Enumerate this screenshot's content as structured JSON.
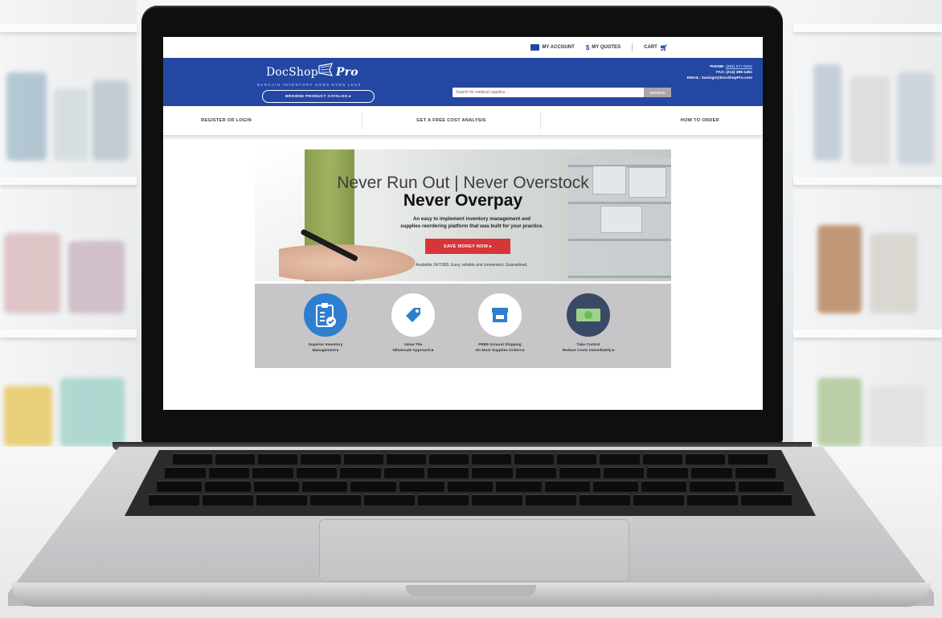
{
  "site": {
    "top_links": {
      "account": "MY ACCOUNT",
      "quotes": "MY QUOTES",
      "cart": "CART"
    },
    "logo": {
      "name_main": "DocShop",
      "name_pro": "Pro",
      "tagline": "BARGAIN INVENTORY GOES EVEN LESS"
    },
    "catalog_button": "BROWSE PRODUCT CATALOG ▸",
    "contact": {
      "phone_label": "PHONE:",
      "phone": "(855) 577-0000",
      "fax": "FAX: (214) 396-1461",
      "email_label": "EMAIL:",
      "email": "Savings@DocShopPro.com"
    },
    "search": {
      "placeholder": "Search for medical supplies...",
      "button": "SEARCH"
    },
    "nav": [
      "REGISTER OR LOGIN",
      "GET A FREE COST ANALYSIS",
      "HOW TO ORDER"
    ],
    "hero": {
      "headline": "Never Run Out | Never Overstock",
      "headline_bold": "Never Overpay",
      "subtext_line1": "An easy to implement inventory management and",
      "subtext_line2": "supplies reordering platform that was built for your practice.",
      "cta": "SAVE MONEY NOW ▸",
      "note": "Available 24/7/365. Easy, reliable and convenient. Guaranteed."
    },
    "features": [
      {
        "icon": "clipboard-check-icon",
        "line1": "Superior Inventory",
        "line2": "Management ▸"
      },
      {
        "icon": "price-tag-icon",
        "line1": "Value The",
        "line2": "Wholesale Approach ▸"
      },
      {
        "icon": "storefront-icon",
        "line1": "FREE Ground Shipping",
        "line2": "On Most Supplies Orders ▸"
      },
      {
        "icon": "money-icon",
        "line1": "Take Control",
        "line2": "Reduce Costs Immediately ▸"
      }
    ]
  },
  "colors": {
    "brand_blue": "#2347a3",
    "cta_red": "#d6353a",
    "feature_band": "#c6c6c8"
  }
}
